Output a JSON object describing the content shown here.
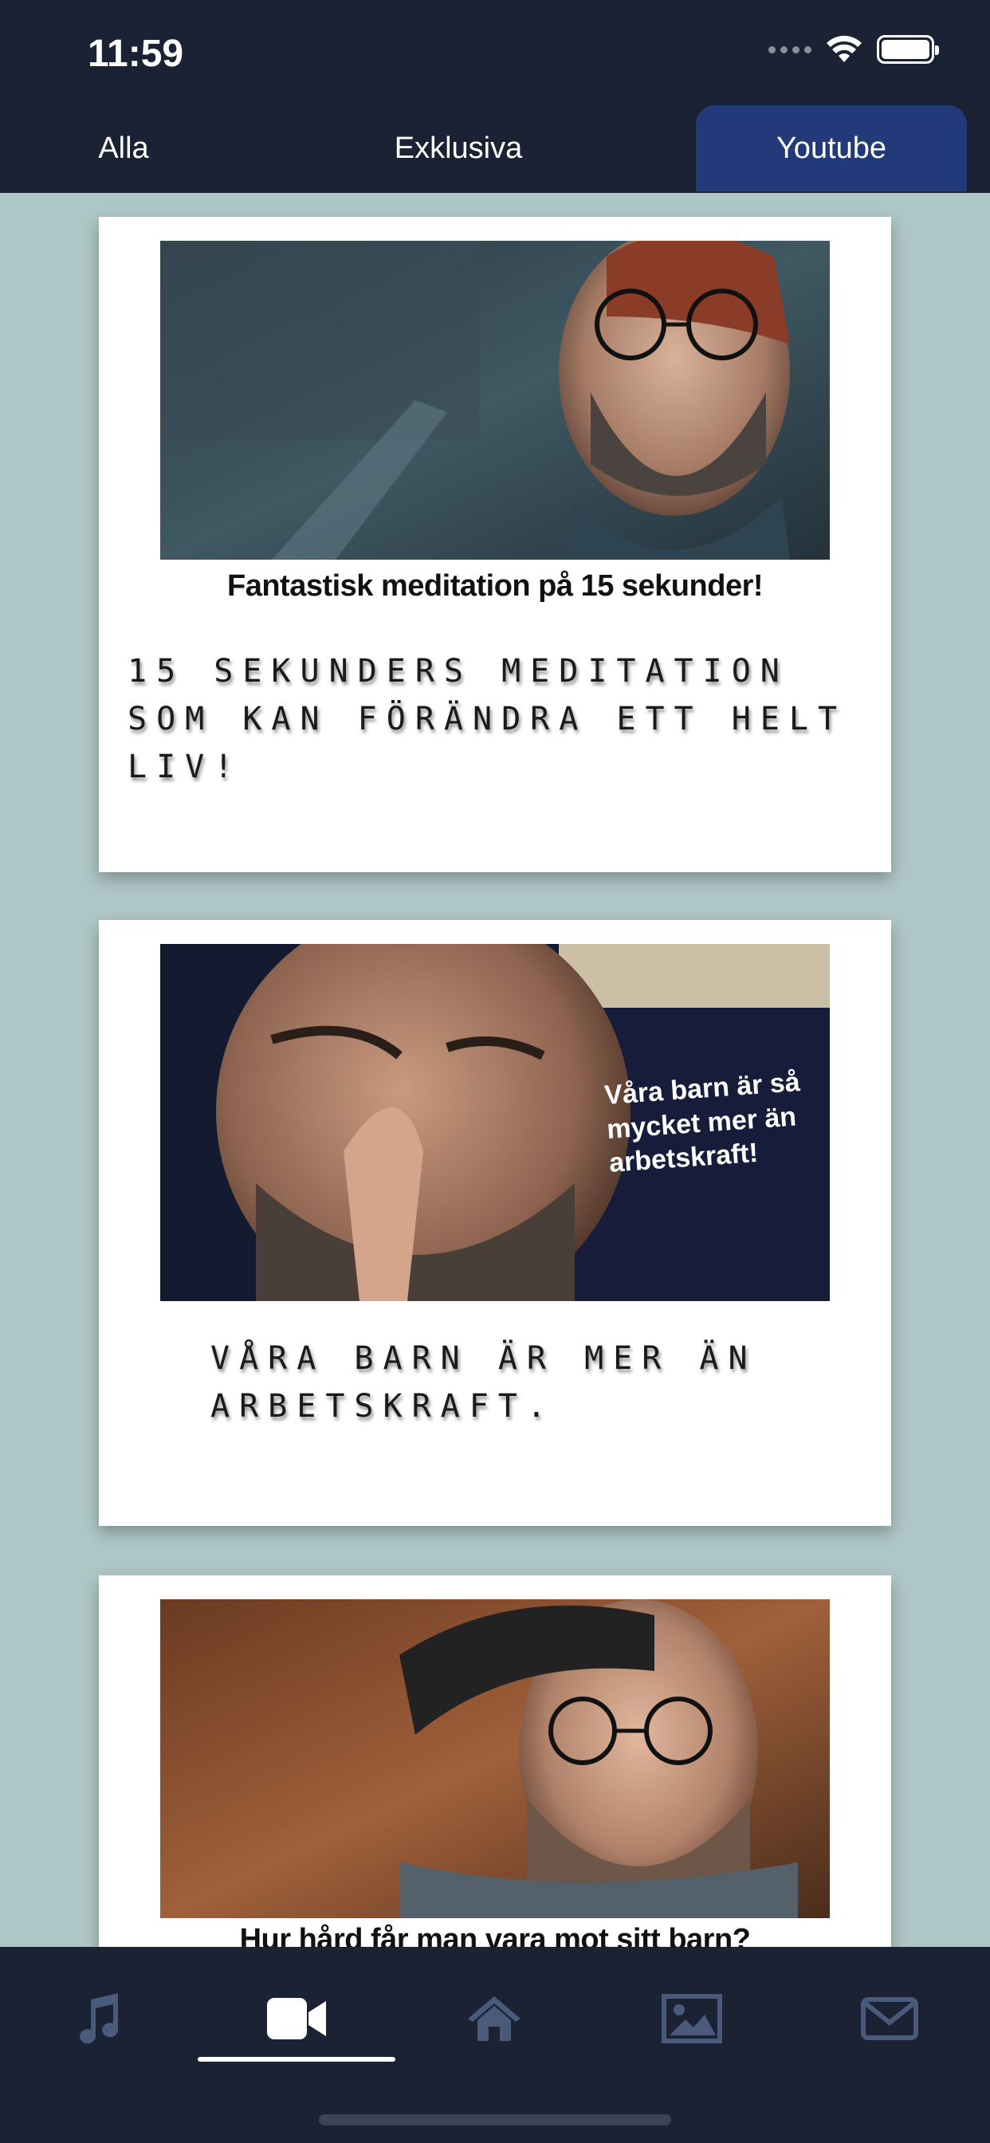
{
  "status_bar": {
    "time": "11:59"
  },
  "tabs": [
    {
      "label": "Alla",
      "active": false
    },
    {
      "label": "Exklusiva",
      "active": false
    },
    {
      "label": "Youtube",
      "active": true
    }
  ],
  "videos": [
    {
      "thumbnail_caption": "Fantastisk meditation på 15 sekunder!",
      "title": "15 sekunders meditation som kan förändra ett helt liv!"
    },
    {
      "thumbnail_overlay": "Våra barn är så mycket mer än arbetskraft!",
      "title": "Våra barn är mer än arbetskraft."
    },
    {
      "thumbnail_caption": "Hur hård får man vara mot sitt barn?",
      "title": ""
    }
  ],
  "bottom_nav": [
    {
      "icon": "music-icon",
      "active": false
    },
    {
      "icon": "video-camera-icon",
      "active": true
    },
    {
      "icon": "home-icon",
      "active": false
    },
    {
      "icon": "image-icon",
      "active": false
    },
    {
      "icon": "mail-icon",
      "active": false
    }
  ],
  "colors": {
    "header_bg": "#1a2233",
    "active_tab": "#22397a",
    "feed_bg": "#aec6c6",
    "icon_inactive": "#4a5a7a",
    "icon_active": "#ffffff"
  }
}
